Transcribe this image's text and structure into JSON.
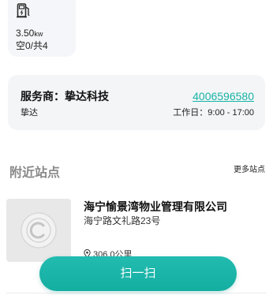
{
  "charger": {
    "icon": "charger-icon",
    "power_value": "3.50",
    "power_unit": "kw",
    "availability": "空0/共4"
  },
  "provider": {
    "label": "服务商：挚达科技",
    "phone": "4006596580",
    "short_name": "挚达",
    "hours": "工作日：9:00 - 17:00"
  },
  "nearby": {
    "title": "附近站点",
    "more_label": "更多站点",
    "stations": [
      {
        "image_icon": "station-logo-icon",
        "name": "海宁愉景湾物业管理有限公司",
        "address": "海宁路文礼路23号",
        "distance_icon": "location-pin-icon",
        "distance": "306.0公里"
      }
    ]
  },
  "actions": {
    "scan_label": "扫一扫"
  },
  "colors": {
    "accent": "#16b3a6",
    "card_background": "#f4f5f7",
    "section_title": "#8a8a8a"
  }
}
